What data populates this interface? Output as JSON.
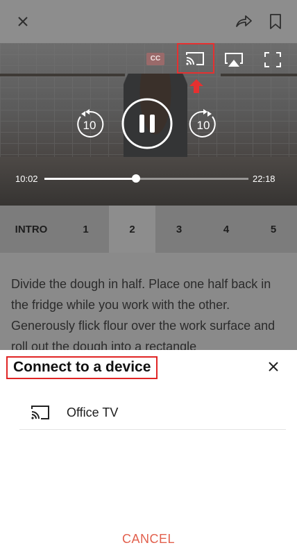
{
  "topbar": {
    "close_icon": "close-icon",
    "share_icon": "share-icon",
    "bookmark_icon": "bookmark-icon"
  },
  "video": {
    "cc_label": "CC",
    "rewind_seconds": "10",
    "forward_seconds": "10",
    "current_time": "10:02",
    "total_time": "22:18",
    "progress_fraction": 0.45,
    "icons": [
      "cast-icon",
      "airplay-icon",
      "fullscreen-icon",
      "pause-icon"
    ]
  },
  "steps": {
    "tabs": [
      "INTRO",
      "1",
      "2",
      "3",
      "4",
      "5"
    ],
    "active_index": 2
  },
  "content": {
    "text": "Divide the dough in half. Place one half back in the fridge while you work with the other. Generously flick flour over the work surface and roll out the dough into a rectangle"
  },
  "sheet": {
    "title": "Connect to a device",
    "devices": [
      {
        "name": "Office TV"
      }
    ],
    "cancel_label": "CANCEL"
  },
  "colors": {
    "highlight": "#e02424",
    "cancel": "#e2604d"
  }
}
